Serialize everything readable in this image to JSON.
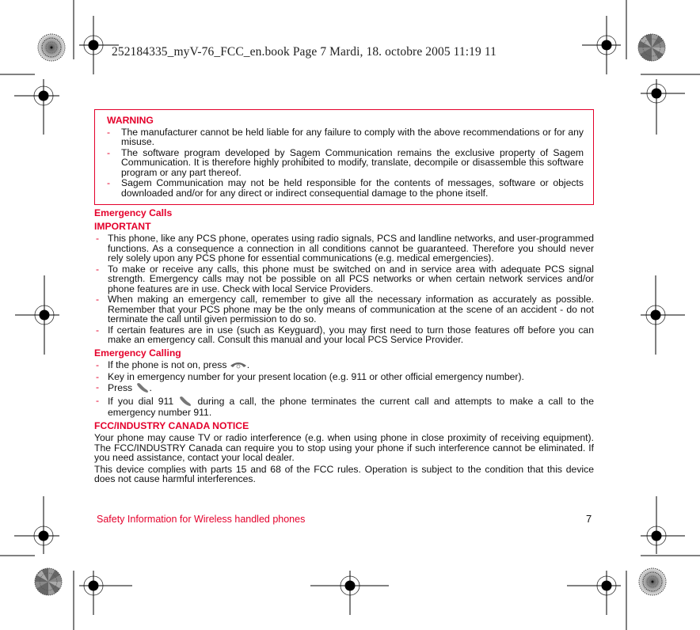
{
  "header": {
    "print_slug": "252184335_myV-76_FCC_en.book  Page 7  Mardi, 18. octobre 2005  11:19 11"
  },
  "warning": {
    "title": "WARNING",
    "items": [
      "The manufacturer cannot be held liable for any failure to comply with the above recommendations or for any misuse.",
      "The software program developed by Sagem Communication remains the exclusive property of Sagem Communication. It is therefore highly prohibited to modify, translate, decompile or disassemble this software program or any part thereof.",
      "Sagem Communication may not be held responsible for the contents of messages, software or objects downloaded and/or for any direct or indirect consequential damage to the phone itself."
    ]
  },
  "emergency_calls": {
    "heading": "Emergency Calls",
    "important_heading": "IMPORTANT",
    "items": [
      "This phone, like any PCS phone, operates using radio signals, PCS and landline networks, and user-programmed functions. As a consequence a connection in all conditions cannot be guaranteed. Therefore you should never rely solely upon any PCS phone for essential communications (e.g. medical emergencies).",
      "To make or receive any calls, this phone must be switched on and in service area with adequate PCS signal strength. Emergency calls may not be possible on all PCS networks or when certain network services and/or phone features are in use. Check with local Service Providers.",
      "When making an emergency call, remember to give all the necessary information as accurately as possible. Remember that your PCS phone may be the only means of communication at the scene of an accident - do not terminate the call until given permission to do so.",
      "If certain features are in use (such as Keyguard), you may first need to turn those features off before you can make an emergency call. Consult this manual and your local PCS Service Provider."
    ]
  },
  "emergency_calling": {
    "heading": "Emergency Calling",
    "item1_before": "If the phone is not on, press ",
    "item1_icon": "power-end-key-icon",
    "item1_after": ".",
    "item2": "Key in emergency number for your present location (e.g. 911 or other official emergency number).",
    "item3_before": "Press ",
    "item3_icon": "call-key-icon",
    "item3_after": ".",
    "item4_before": "If you dial 911 ",
    "item4_icon": "call-key-icon",
    "item4_after": " during a call, the phone terminates the current call and attempts to make a call to the emergency number 911."
  },
  "fcc": {
    "heading": "FCC/INDUSTRY CANADA NOTICE",
    "paragraphs": [
      "Your phone may cause TV or radio interference (e.g. when using phone in close proximity of receiving equipment). The FCC/INDUSTRY Canada can require you to stop using your phone if such interference cannot be eliminated. If you need assistance, contact your local dealer.",
      "This device complies with parts 15 and 68 of the FCC rules. Operation is subject to the condition that this device does not cause harmful interferences."
    ]
  },
  "footer": {
    "section_title": "Safety Information for Wireless handled phones",
    "page_number": "7"
  },
  "colors": {
    "accent_red": "#e4002b",
    "text": "#111111"
  }
}
